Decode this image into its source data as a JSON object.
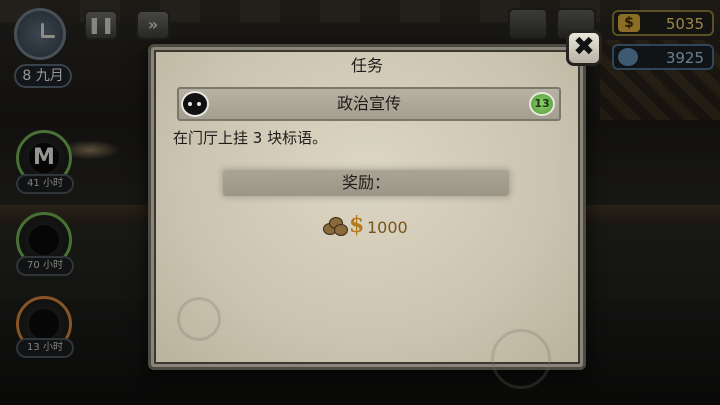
{
  "hud": {
    "date_day": "8",
    "date_month": "九月",
    "pause_icon": "pause-icon",
    "fast_forward_icon": "fast-forward-icon",
    "money": "5035",
    "money_symbol": "$",
    "tokens": "3925"
  },
  "characters": [
    {
      "glyph": "M",
      "hours": "41 小时"
    },
    {
      "glyph": "",
      "hours": "70 小时"
    },
    {
      "glyph": "",
      "hours": "13 小时"
    }
  ],
  "dialog": {
    "title": "任务",
    "task_name": "政治宣传",
    "task_level": "13",
    "description": "在门厅上挂 3 块标语。",
    "reward_label": "奖励：",
    "reward_currency": "$",
    "reward_amount": "1000",
    "close_symbol": "✖"
  },
  "colors": {
    "dialog_paper": "#d5cfbd",
    "money_gold": "#efcf6e",
    "level_green": "#6fb54e",
    "token_blue": "#9fc4e4"
  }
}
